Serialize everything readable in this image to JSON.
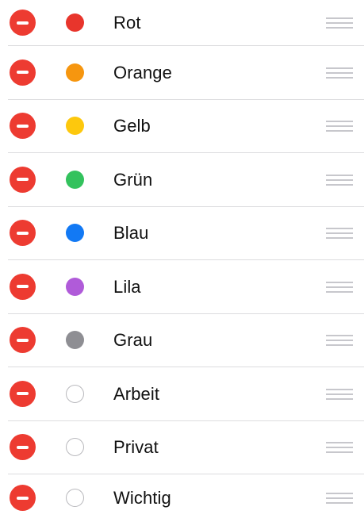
{
  "colors_list": {
    "items": [
      {
        "label": "Rot",
        "dot_color": "#e8352c",
        "dot_style": "filled"
      },
      {
        "label": "Orange",
        "dot_color": "#f6960f",
        "dot_style": "filled"
      },
      {
        "label": "Gelb",
        "dot_color": "#fdc80d",
        "dot_style": "filled"
      },
      {
        "label": "Grün",
        "dot_color": "#33c25d",
        "dot_style": "filled"
      },
      {
        "label": "Blau",
        "dot_color": "#1279f4",
        "dot_style": "filled"
      },
      {
        "label": "Lila",
        "dot_color": "#b05bd9",
        "dot_style": "filled"
      },
      {
        "label": "Grau",
        "dot_color": "#8e8e93",
        "dot_style": "filled"
      },
      {
        "label": "Arbeit",
        "dot_color": "#ffffff",
        "dot_style": "outline"
      },
      {
        "label": "Privat",
        "dot_color": "#ffffff",
        "dot_style": "outline"
      },
      {
        "label": "Wichtig",
        "dot_color": "#ffffff",
        "dot_style": "outline"
      }
    ]
  },
  "icons": {
    "delete": "minus-circle-icon",
    "reorder": "reorder-handle-icon"
  },
  "theme": {
    "delete_color": "#ed3b31",
    "separator_color": "#dcdcde",
    "handle_color": "#c7c7cc"
  }
}
